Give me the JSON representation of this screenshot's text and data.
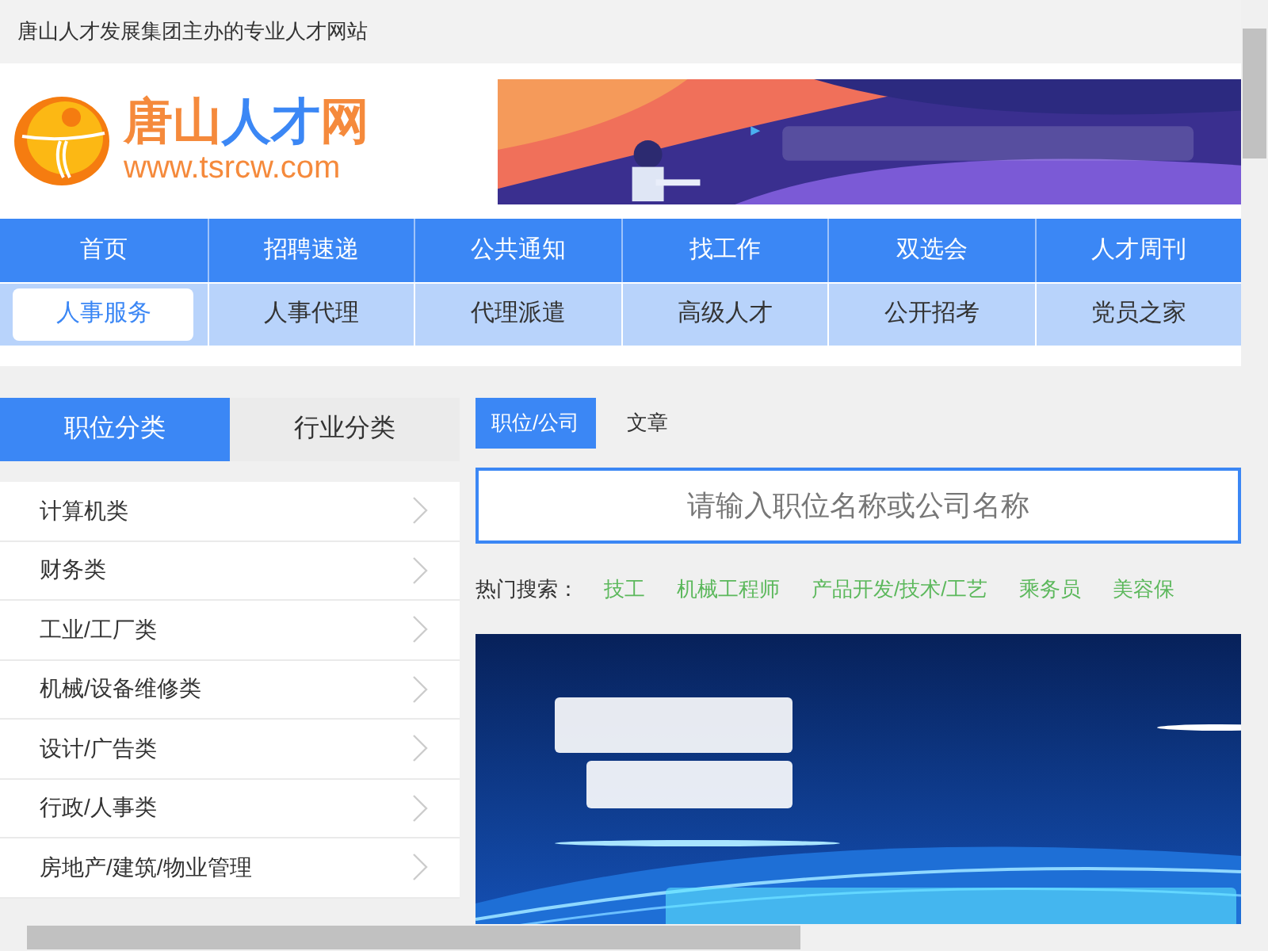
{
  "top_bar": {
    "text": "唐山人才发展集团主办的专业人才网站"
  },
  "logo": {
    "title_parts": [
      {
        "text": "唐山",
        "color": "#f58a3c"
      },
      {
        "text": "人才",
        "color": "#3b87f5"
      },
      {
        "text": "网",
        "color": "#f58a3c"
      }
    ],
    "url": "www.tsrcw.com"
  },
  "nav_primary": [
    {
      "label": "首页"
    },
    {
      "label": "招聘速递"
    },
    {
      "label": "公共通知"
    },
    {
      "label": "找工作"
    },
    {
      "label": "双选会"
    },
    {
      "label": "人才周刊"
    }
  ],
  "nav_secondary": [
    {
      "label": "人事服务",
      "selected": true
    },
    {
      "label": "人事代理",
      "selected": false
    },
    {
      "label": "代理派遣",
      "selected": false
    },
    {
      "label": "高级人才",
      "selected": false
    },
    {
      "label": "公开招考",
      "selected": false
    },
    {
      "label": "党员之家",
      "selected": false
    }
  ],
  "category_tabs": [
    {
      "label": "职位分类",
      "selected": true
    },
    {
      "label": "行业分类",
      "selected": false
    }
  ],
  "categories": [
    {
      "label": "计算机类"
    },
    {
      "label": "财务类"
    },
    {
      "label": "工业/工厂类"
    },
    {
      "label": "机械/设备维修类"
    },
    {
      "label": "设计/广告类"
    },
    {
      "label": "行政/人事类"
    },
    {
      "label": "房地产/建筑/物业管理"
    }
  ],
  "search_tabs": [
    {
      "label": "职位/公司",
      "selected": true
    },
    {
      "label": "文章",
      "selected": false
    }
  ],
  "search": {
    "placeholder": "请输入职位名称或公司名称"
  },
  "hot_search": {
    "label": "热门搜索：",
    "terms": [
      "技工",
      "机械工程师",
      "产品开发/技术/工艺",
      "乘务员",
      "美容保"
    ]
  }
}
